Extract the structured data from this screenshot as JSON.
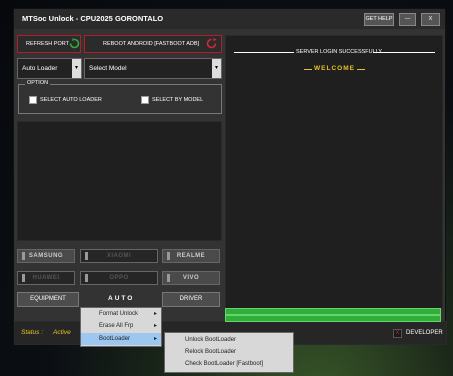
{
  "window": {
    "title": "MTSoc Unlock  -  CPU2025 GORONTALO",
    "get_help": "GET HELP",
    "minimize": "—",
    "close": "X"
  },
  "left": {
    "refresh_port": "REFRESH PORT",
    "reboot_android": "REBOOT ANDROID [FASTBOOT ADB]",
    "loader_combo": "Auto Loader",
    "model_combo": "Select Model",
    "option_title": "OPTION",
    "select_auto_loader": "SELECT AUTO LOADER",
    "select_by_model": "SELECT BY MODEL"
  },
  "brands": {
    "samsung": "SAMSUNG",
    "xiaomi": "XIAOMI",
    "realme": "REALME",
    "huawei": "HUAWEI",
    "oppo": "OPPO",
    "vivo": "VIVO"
  },
  "actions": {
    "equipment": "EQUIPMENT",
    "auto": "AUTO",
    "driver": "DRIVER"
  },
  "status": {
    "label": "Status :",
    "value": "Active"
  },
  "right": {
    "server_msg": "SERVER LOGIN SUCCESSFULLY",
    "welcome": "WELCOME",
    "developer": "DEVELOPER"
  },
  "context_menu": {
    "items": [
      "Format Unlock",
      "Erase All Frp",
      "BootLoader"
    ],
    "submenu": [
      "Unlock BootLoader",
      "Relock BootLoader",
      "Check BootLoader [Fastboot]"
    ]
  },
  "colors": {
    "accent_red": "#b01e2a",
    "refresh_green": "#2fae3a",
    "welcome_yellow": "#e6c229",
    "menu_highlight": "#9bc7f0"
  }
}
